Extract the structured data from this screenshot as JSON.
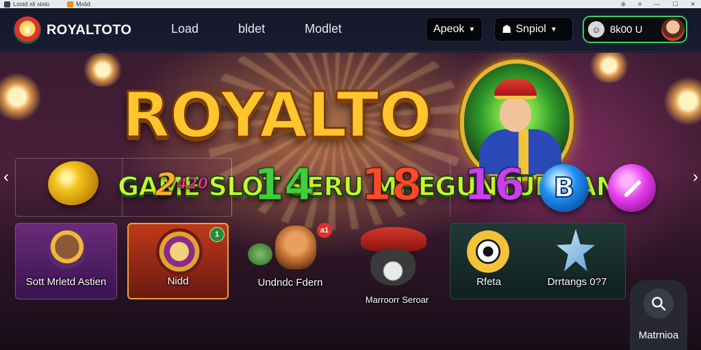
{
  "titlebar": {
    "title": "Lsoid ʌli ʌlʌlo",
    "tab": "Mʌlid"
  },
  "brand": {
    "name": "ROYALTOTO"
  },
  "nav": {
    "links": [
      "Load",
      "bldet",
      "Modlet"
    ]
  },
  "controls": {
    "language": "Apeok",
    "symbol": "Snpiol",
    "wallet": "8k00 U"
  },
  "hero": {
    "title": "ROYALTO",
    "subtitle": "GAME SLOT SERU MHEGUNTUNGAN"
  },
  "tokens": {
    "t1": "2",
    "t1_sub": "420",
    "t2": "14",
    "t3": "18",
    "t4": "16",
    "t5": "B"
  },
  "games": [
    {
      "label": "Sott Mrletd Astien"
    },
    {
      "label": "Nidd",
      "badge": "1"
    },
    {
      "label": "Undndc Fdern",
      "badge": "a1"
    },
    {
      "label": "Marroorr Seroar"
    },
    {
      "label": "Rfeta"
    },
    {
      "label": "Drrtangs 0?7"
    }
  ],
  "search": {
    "label": "Matrnioa"
  },
  "colors": {
    "accent": "#3fcf5f",
    "title_gold": "#ffc52c",
    "subtitle_green": "#c9f52a"
  }
}
